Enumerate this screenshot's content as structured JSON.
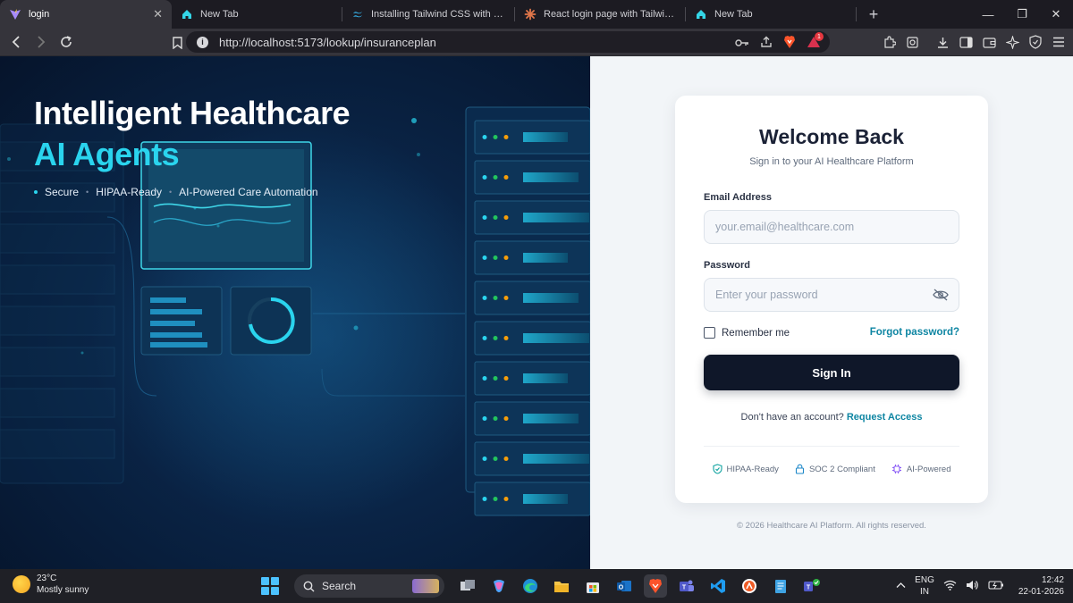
{
  "browser": {
    "tabs": [
      {
        "title": "login",
        "active": true,
        "icon": "vite-logo-icon"
      },
      {
        "title": "New Tab",
        "active": false,
        "icon": "home-icon"
      },
      {
        "title": "Installing Tailwind CSS with Vite - Tail",
        "active": false,
        "icon": "tailwind-logo-icon"
      },
      {
        "title": "React login page with Tailwind and Sh",
        "active": false,
        "icon": "claude-logo-icon"
      },
      {
        "title": "New Tab",
        "active": false,
        "icon": "home-icon"
      }
    ],
    "url": "http://localhost:5173/lookup/insuranceplan",
    "notification_count": "1"
  },
  "hero": {
    "title": "Intelligent Healthcare",
    "subtitle": "AI Agents",
    "tags": [
      "Secure",
      "HIPAA-Ready",
      "AI-Powered Care Automation"
    ]
  },
  "login": {
    "title": "Welcome Back",
    "subtitle": "Sign in to your AI Healthcare Platform",
    "email_label": "Email Address",
    "email_placeholder": "your.email@healthcare.com",
    "password_label": "Password",
    "password_placeholder": "Enter your password",
    "remember_label": "Remember me",
    "forgot_label": "Forgot password?",
    "signin_label": "Sign In",
    "signup_prompt": "Don't have an account?",
    "signup_link": "Request Access",
    "badges": [
      "HIPAA-Ready",
      "SOC 2 Compliant",
      "AI-Powered"
    ],
    "copyright": "© 2026 Healthcare AI Platform. All rights reserved."
  },
  "taskbar": {
    "temperature": "23°C",
    "weather": "Mostly sunny",
    "search_label": "Search",
    "lang_line1": "ENG",
    "lang_line2": "IN",
    "time": "12:42",
    "date": "22-01-2026"
  },
  "colors": {
    "accent_cyan": "#2ad4ee",
    "primary_dark": "#0f1729",
    "link_teal": "#0f86a3",
    "hero_bg": "#0a2446"
  }
}
